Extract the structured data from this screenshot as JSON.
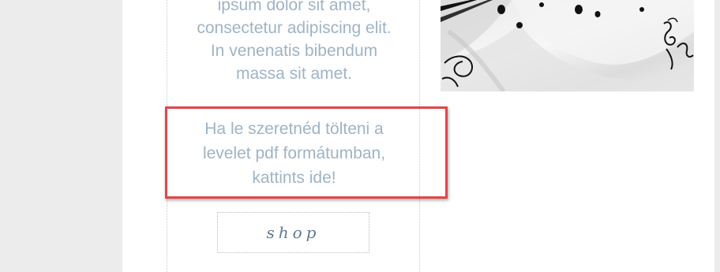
{
  "content": {
    "lorem_text": "ipsum dolor sit amet,\nconsectetur adipiscing elit.\nIn venenatis bibendum\nmassa sit amet.",
    "pdf_link_text": "Ha le szeretnéd tölteni a\nlevelet pdf formátumban,\nkattints ide!",
    "shop_label": "shop"
  },
  "colors": {
    "text": "#9fb4c6",
    "highlight": "#e0474c",
    "shop_text": "#5f7a92"
  },
  "icons": {
    "product_photo": "fabric-photo"
  }
}
